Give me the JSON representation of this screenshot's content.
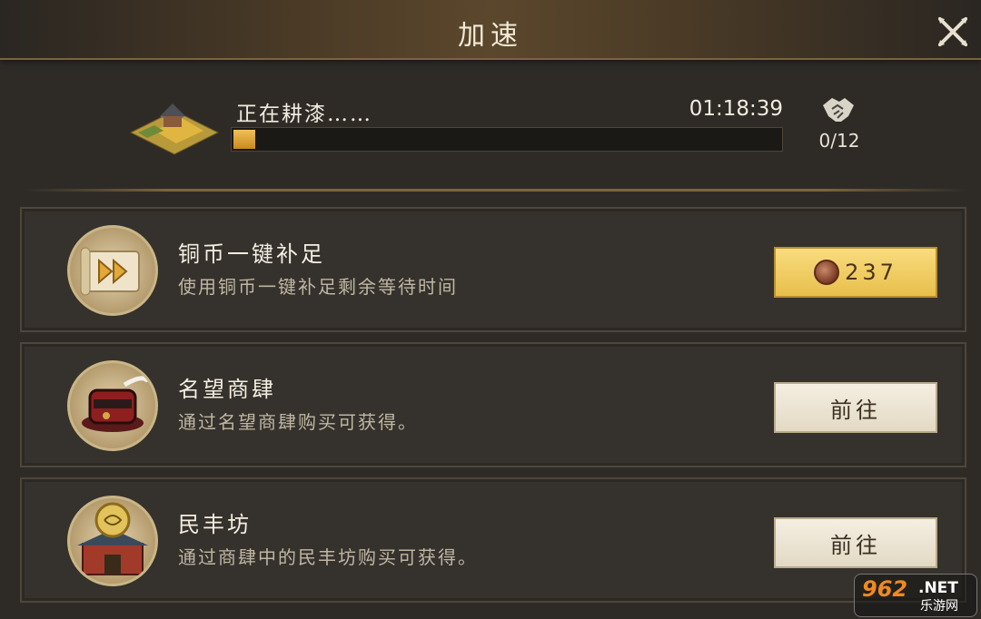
{
  "header": {
    "title": "加速"
  },
  "status": {
    "text": "正在耕漆……",
    "timer": "01:18:39",
    "help_count": "0/12",
    "progress_fraction": 0.04
  },
  "rows": [
    {
      "title": "铜币一键补足",
      "desc": "使用铜币一键补足剩余等待时间",
      "button_value": "237",
      "icon": "scroll-fast-forward-icon"
    },
    {
      "title": "名望商肆",
      "desc": "通过名望商肆购买可获得。",
      "button_label": "前往",
      "icon": "red-hat-icon"
    },
    {
      "title": "民丰坊",
      "desc": "通过商肆中的民丰坊购买可获得。",
      "button_label": "前往",
      "icon": "shop-building-icon"
    }
  ],
  "watermark": {
    "top": "962",
    "net": ".NET",
    "bottom": "乐游网"
  },
  "colors": {
    "gold_button": "#e8bf4c",
    "progress": "#d49a2a"
  }
}
